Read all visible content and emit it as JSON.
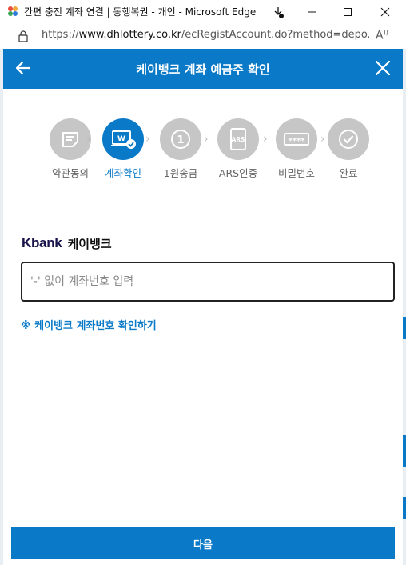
{
  "window": {
    "title": "간편 충전 계좌 연결 | 동행복권 - 개인 - Microsoft Edge",
    "minimize_icon": "minimize-icon",
    "maximize_icon": "maximize-icon",
    "close_icon": "close-icon"
  },
  "address_bar": {
    "url_prefix": "https://",
    "url_host": "www.dhlottery.co.kr",
    "url_path": "/ecRegistAccount.do?method=depo..."
  },
  "modal": {
    "title": "케이뱅크 계좌 예금주 확인",
    "header_color": "#0a7ac8"
  },
  "steps": [
    {
      "label": "약관동의",
      "icon": "document-icon",
      "active": false
    },
    {
      "label": "계좌확인",
      "icon": "account-check-icon",
      "active": true
    },
    {
      "label": "1원송금",
      "icon": "one-won-icon",
      "active": false
    },
    {
      "label": "ARS인증",
      "icon": "ars-phone-icon",
      "active": false
    },
    {
      "label": "비밀번호",
      "icon": "password-icon",
      "active": false
    },
    {
      "label": "완료",
      "icon": "check-complete-icon",
      "active": false
    }
  ],
  "bank": {
    "logo_text": "Kbank",
    "name": "케이뱅크"
  },
  "account_input": {
    "value": "",
    "placeholder": "'-' 없이 계좌번호 입력"
  },
  "note_link": "※ 케이뱅크 계좌번호 확인하기",
  "next_button": "다음"
}
